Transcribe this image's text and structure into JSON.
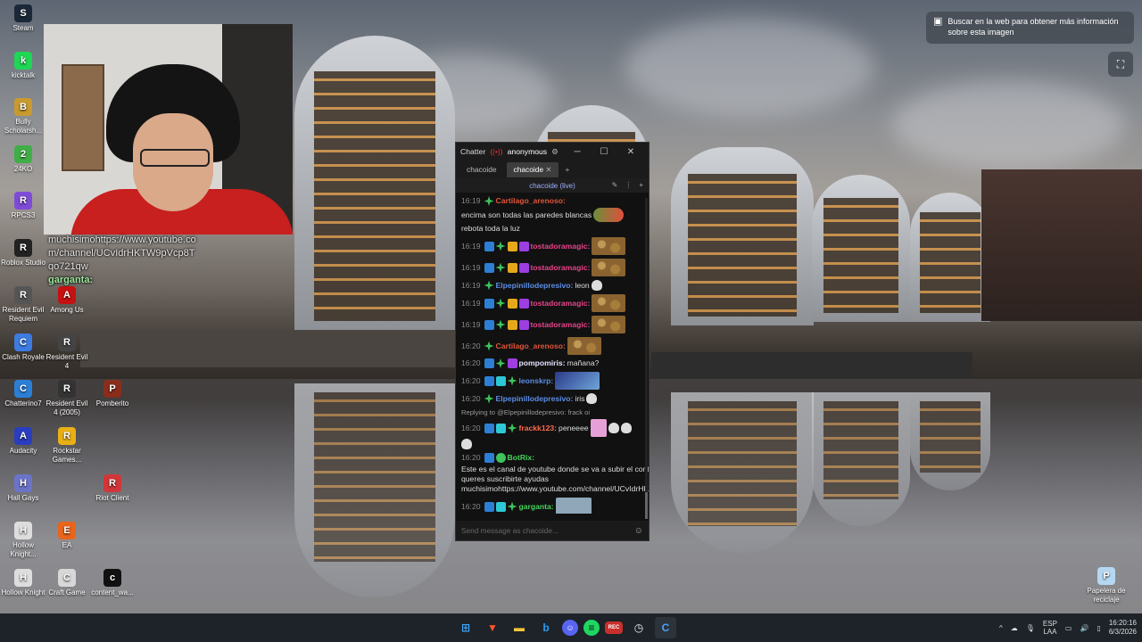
{
  "desktop_icons": [
    {
      "label": "Steam",
      "icon": "steam-icon",
      "color": "#1b2838"
    },
    {
      "label": "kicktalk",
      "icon": "kicktalk-icon",
      "color": "#1fd655"
    },
    {
      "label": "Bully Scholarsh...",
      "icon": "bully-icon",
      "color": "#c99a2e"
    },
    {
      "label": "24KO",
      "icon": "24ko-icon",
      "color": "#3fae46"
    },
    {
      "label": "RPCS3",
      "icon": "rpcs3-icon",
      "color": "#7e4bd6"
    },
    {
      "label": "Roblox Studio",
      "icon": "roblox-studio-icon",
      "color": "#222222"
    },
    {
      "label": "Resident Evil Requiem",
      "icon": "re-requiem-icon",
      "color": "#555555"
    },
    {
      "label": "Among Us",
      "icon": "among-us-icon",
      "color": "#c51111"
    },
    {
      "label": "Clash Royale",
      "icon": "clash-royale-icon",
      "color": "#3d7be0"
    },
    {
      "label": "Resident Evil 4",
      "icon": "re4-icon",
      "color": "#444444"
    },
    {
      "label": "Chatterino7",
      "icon": "chatterino-icon",
      "color": "#2b7fd6"
    },
    {
      "label": "Resident Evil 4 (2005)",
      "icon": "re4-2005-icon",
      "color": "#333333"
    },
    {
      "label": "Pomberito",
      "icon": "pomberito-icon",
      "color": "#8a2d1c"
    },
    {
      "label": "Audacity",
      "icon": "audacity-icon",
      "color": "#2a3dbf"
    },
    {
      "label": "Rockstar Games...",
      "icon": "rockstar-icon",
      "color": "#e8b016"
    },
    {
      "label": "Hall Gays",
      "icon": "hall-gays-icon",
      "color": "#6b74c9"
    },
    {
      "label": "Riot Client",
      "icon": "riot-client-icon",
      "color": "#d13639"
    },
    {
      "label": "Hollow Knight...",
      "icon": "hollow-knight-icon",
      "color": "#dddddd"
    },
    {
      "label": "EA",
      "icon": "ea-icon",
      "color": "#e8651c"
    },
    {
      "label": "Hollow Knight",
      "icon": "hollow-knight-2-icon",
      "color": "#dddddd"
    },
    {
      "label": "Craft Game",
      "icon": "craft-game-icon",
      "color": "#d8d8d8"
    },
    {
      "label": "content_wa...",
      "icon": "content-file-icon",
      "color": "#111111"
    },
    {
      "label": "Papelera de reciclaje",
      "icon": "recycle-bin-icon",
      "color": "#b5d8f2"
    }
  ],
  "overlay_chat": {
    "line1": "muchisimohttps://www.youtube.com/channel/UCvIdrHKTW9pVcp8Tqo721qw",
    "line2": "garganta:"
  },
  "search_pill": {
    "text": "Buscar en la web para obtener más información sobre esta imagen"
  },
  "chatterino": {
    "title": "Chatter",
    "user": "anonymous",
    "tabs": [
      "chacoide",
      "chacoide"
    ],
    "channel": "chacoide (live)",
    "input_placeholder": "Send message as chacoide...",
    "messages": [
      {
        "time": "16:19",
        "user": "Cartilago_arenoso:",
        "user_color": "#e0553a",
        "text": "encima son todas las paredes blancas",
        "text2": "rebota toda la luz"
      },
      {
        "time": "16:19",
        "user": "tostadoramagic:",
        "user_color": "#e6448a",
        "text": ""
      },
      {
        "time": "16:19",
        "user": "tostadoramagic:",
        "user_color": "#e6448a",
        "text": ""
      },
      {
        "time": "16:19",
        "user": "Elpepinillodepresivo:",
        "user_color": "#5c8de6",
        "text": "leon"
      },
      {
        "time": "16:19",
        "user": "tostadoramagic:",
        "user_color": "#e6448a",
        "text": ""
      },
      {
        "time": "16:19",
        "user": "tostadoramagic:",
        "user_color": "#e6448a",
        "text": ""
      },
      {
        "time": "16:20",
        "user": "Cartilago_arenoso:",
        "user_color": "#e0553a",
        "text": ""
      },
      {
        "time": "16:20",
        "user": "pompomiris:",
        "user_color": "#e8e0ff",
        "text": "mañana?"
      },
      {
        "time": "16:20",
        "user": "leonskrp:",
        "user_color": "#5c8de6",
        "text": ""
      },
      {
        "time": "16:20",
        "user": "Elpepinillodepresivo:",
        "user_color": "#5c8de6",
        "text": "iris"
      },
      {
        "time": "16:20",
        "user": "frackk123:",
        "user_color": "#ff6a4d",
        "text": "peneeee"
      },
      {
        "time": "16:20",
        "user": "BotRix:",
        "user_color": "#48d35b",
        "text": "Este es el canal de youtube donde se va a subir el contenido del canal, si queres suscribirte ayudas muchisimohttps://www.youtube.com/channel/UCvIdrHKTW9pVcp8Tqo721qw"
      },
      {
        "time": "16:20",
        "user": "garganta:",
        "user_color": "#48d35b",
        "text": ""
      }
    ],
    "reply_text": "Replying to @Elpepinillodepresivo: frack oi"
  },
  "taskbar": {
    "lang_top": "ESP",
    "lang_bottom": "LAA",
    "time": "16:20:16",
    "date": "6/3/2026"
  }
}
